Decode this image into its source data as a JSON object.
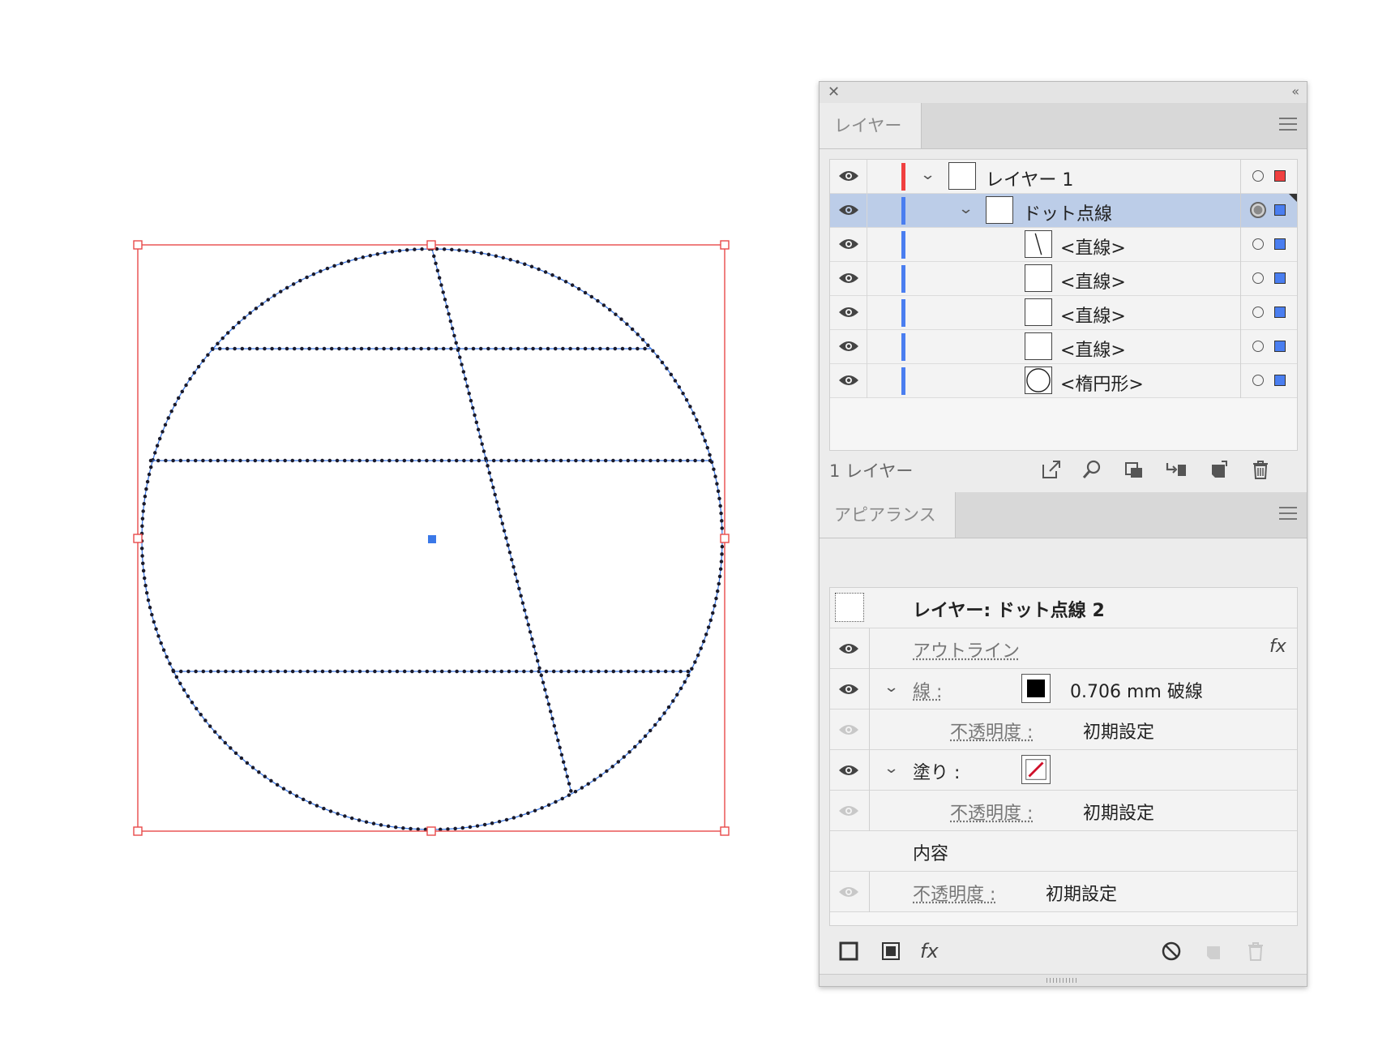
{
  "layers_panel": {
    "tab_label": "レイヤー",
    "rows": [
      {
        "name": "レイヤー 1",
        "color": "#f04040",
        "expanded": true,
        "selected": false
      },
      {
        "name": "ドット点線",
        "color": "#4a7ef0",
        "expanded": true,
        "selected": true
      },
      {
        "name": "<直線>",
        "color": "#4a7ef0"
      },
      {
        "name": "<直線>",
        "color": "#4a7ef0"
      },
      {
        "name": "<直線>",
        "color": "#4a7ef0"
      },
      {
        "name": "<直線>",
        "color": "#4a7ef0"
      },
      {
        "name": "<楕円形>",
        "color": "#4a7ef0"
      }
    ],
    "footer_count": "1 レイヤー"
  },
  "appearance_panel": {
    "tab_label": "アピアランス",
    "header_title": "レイヤー: ドット点線 2",
    "outline_label": "アウトライン",
    "fx_label": "fx",
    "stroke_label": "線 :",
    "stroke_value": "0.706 mm 破線",
    "stroke_opacity_label": "不透明度 :",
    "stroke_opacity_value": "初期設定",
    "fill_label": "塗り :",
    "fill_opacity_label": "不透明度 :",
    "fill_opacity_value": "初期設定",
    "contents_label": "内容",
    "layer_opacity_label": "不透明度 :",
    "layer_opacity_value": "初期設定",
    "fx_menu_label": "fx"
  },
  "colors": {
    "bbox": "#e84a4a",
    "path": "#3a78e8",
    "dots": "#1a1a2a",
    "selection": "#bccde8"
  }
}
